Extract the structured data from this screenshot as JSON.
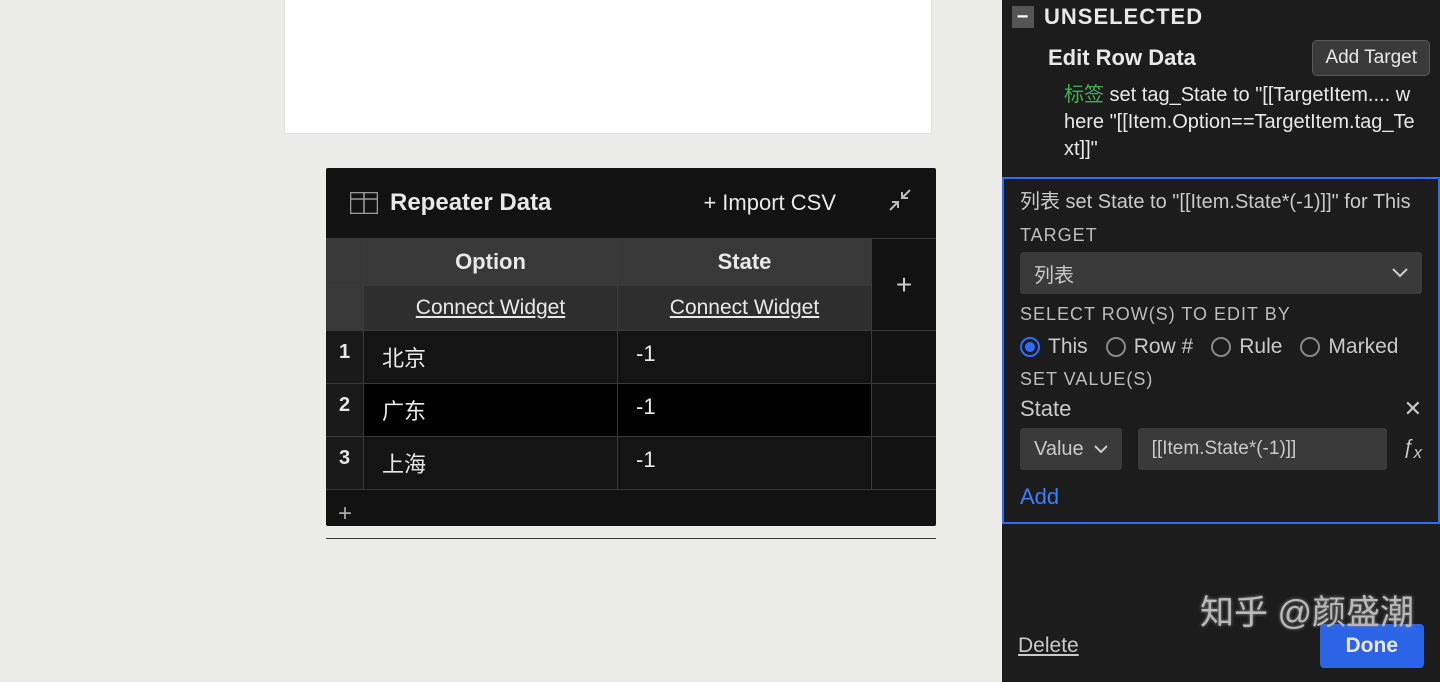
{
  "repeater": {
    "title": "Repeater Data",
    "import_label": "Import CSV",
    "columns": [
      "Option",
      "State"
    ],
    "connect_label": "Connect Widget",
    "rows": [
      {
        "num": "1",
        "option": "北京",
        "state": "-1"
      },
      {
        "num": "2",
        "option": "广东",
        "state": "-1"
      },
      {
        "num": "3",
        "option": "上海",
        "state": "-1"
      }
    ]
  },
  "inspector": {
    "event_name": "UNSELECTED",
    "action_name": "Edit Row Data",
    "add_target_label": "Add Target",
    "action1_tag": "标签",
    "action1_rest": " set tag_State to \"[[TargetItem.... where \"[[Item.Option==TargetItem.tag_Text]]\"",
    "selected_summary": "列表 set State to \"[[Item.State*(-1)]]\" for This",
    "target_label": "TARGET",
    "target_value": "列表",
    "select_rows_label": "SELECT ROW(S) TO EDIT BY",
    "radios": {
      "this": "This",
      "rownum": "Row #",
      "rule": "Rule",
      "marked": "Marked"
    },
    "selected_radio": "this",
    "set_values_label": "SET VALUE(S)",
    "set_value_name": "State",
    "value_dropdown": "Value",
    "value_expression": "[[Item.State*(-1)]]",
    "add_label": "Add",
    "delete_label": "Delete",
    "done_label": "Done"
  },
  "watermark": "知乎 @颜盛潮"
}
